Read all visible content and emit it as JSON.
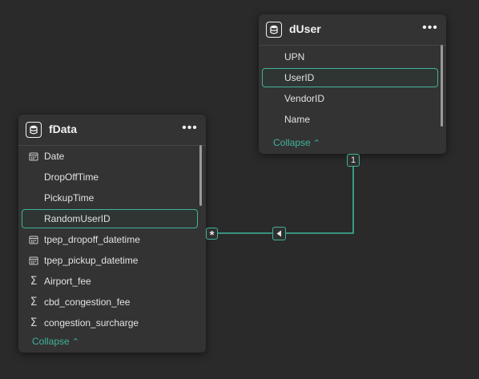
{
  "diagram": {
    "fdata": {
      "title": "fData",
      "more_label": "•••",
      "fields": [
        {
          "name": "Date",
          "icon": "calendar-icon"
        },
        {
          "name": "DropOffTime",
          "icon": ""
        },
        {
          "name": "PickupTime",
          "icon": ""
        },
        {
          "name": "RandomUserID",
          "icon": "",
          "selected": true
        },
        {
          "name": "tpep_dropoff_datetime",
          "icon": "calendar-icon"
        },
        {
          "name": "tpep_pickup_datetime",
          "icon": "calendar-icon"
        },
        {
          "name": "Airport_fee",
          "icon": "sigma-icon"
        },
        {
          "name": "cbd_congestion_fee",
          "icon": "sigma-icon"
        },
        {
          "name": "congestion_surcharge",
          "icon": "sigma-icon"
        }
      ],
      "collapse_label": "Collapse"
    },
    "duser": {
      "title": "dUser",
      "more_label": "•••",
      "fields": [
        {
          "name": "UPN",
          "icon": ""
        },
        {
          "name": "UserID",
          "icon": "",
          "selected": true
        },
        {
          "name": "VendorID",
          "icon": ""
        },
        {
          "name": "Name",
          "icon": ""
        }
      ],
      "collapse_label": "Collapse"
    },
    "relationship": {
      "from_cardinality": "*",
      "to_cardinality": "1",
      "direction": "single",
      "line_color": "#3fb39a"
    }
  }
}
